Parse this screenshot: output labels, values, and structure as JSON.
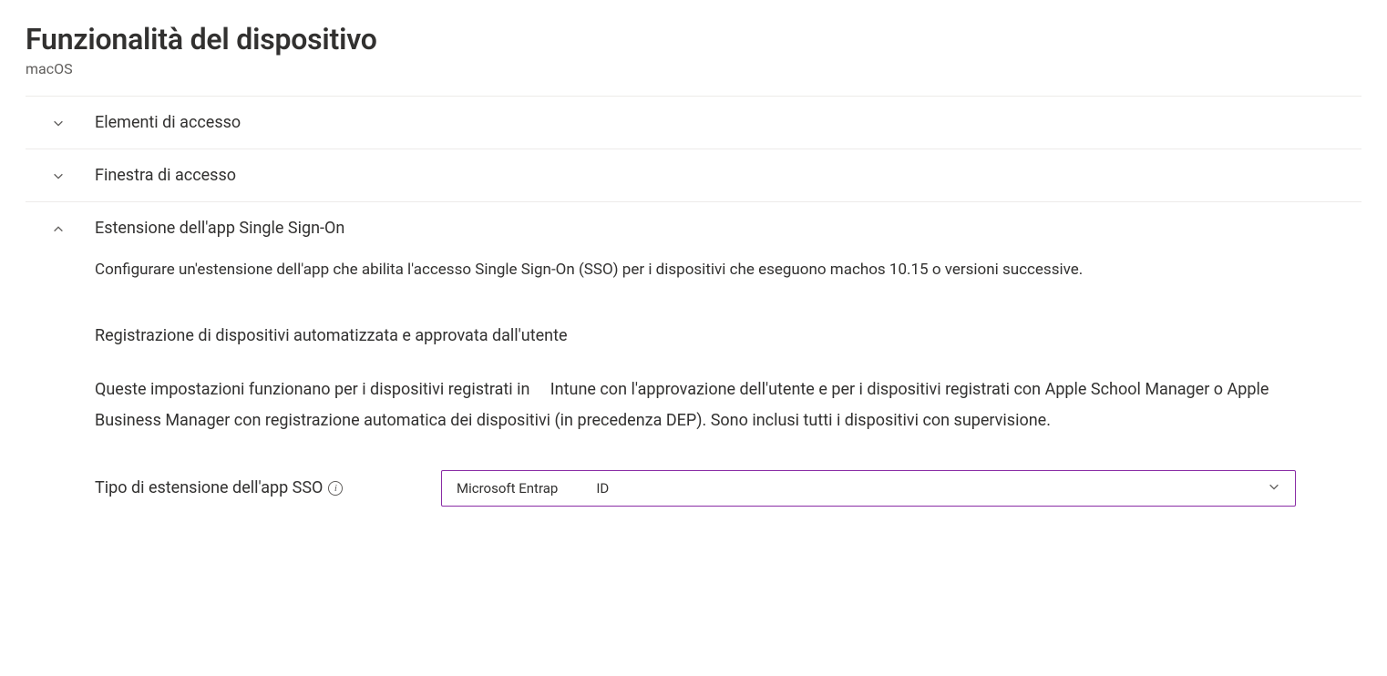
{
  "header": {
    "title": "Funzionalità del dispositivo",
    "subtitle": "macOS"
  },
  "sections": {
    "login_items": {
      "label": "Elementi di accesso"
    },
    "login_window": {
      "label": "Finestra di accesso"
    },
    "sso_extension": {
      "label": "Estensione dell'app Single Sign-On",
      "description": "Configurare un'estensione dell'app che abilita l'accesso Single Sign-On (SSO) per i dispositivi che eseguono machos 10.15 o versioni successive.",
      "subheading": "Registrazione di dispositivi automatizzata e approvata dall'utente",
      "paragraph": "Queste impostazioni funzionano per i dispositivi registrati in     Intune con l'approvazione dell'utente e per i dispositivi registrati con Apple School Manager o Apple Business Manager con registrazione automatica dei dispositivi (in precedenza DEP). Sono inclusi tutti i dispositivi con supervisione.",
      "field": {
        "label": "Tipo di estensione dell'app SSO",
        "select_value_part1": "Microsoft Entrap",
        "select_value_part2": "ID"
      }
    }
  }
}
